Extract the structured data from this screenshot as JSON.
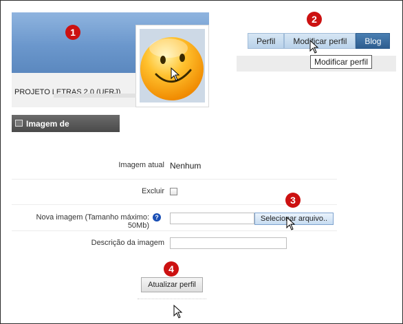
{
  "header": {
    "site_title": "PROJETO LETRAS 2.0 (UFRJ)",
    "avatar_icon": "smiley-face-icon"
  },
  "tabs": [
    {
      "label": "Perfil"
    },
    {
      "label": "Modificar perfil"
    },
    {
      "label": "Blog"
    }
  ],
  "tooltip": "Modificar perfil",
  "section": {
    "title": "Imagem de",
    "icon": "image-icon"
  },
  "form": {
    "current_image_label": "Imagem atual",
    "current_image_value": "Nenhum",
    "delete_label": "Excluir",
    "delete_checked": false,
    "new_image_label": "Nova imagem (Tamanho máximo: 50Mb)",
    "help_icon": "help-icon",
    "help_glyph": "?",
    "file_value": "",
    "select_file_button": "Selecionar arquivo..",
    "description_label": "Descrição da imagem",
    "description_value": "",
    "submit_button": "Atualizar perfil"
  },
  "callouts": [
    "1",
    "2",
    "3",
    "4"
  ],
  "colors": {
    "callout": "#cc1111",
    "tab_active": "#2e5d8f",
    "banner": "#6b97cc",
    "section_header": "#4a4a4a"
  }
}
